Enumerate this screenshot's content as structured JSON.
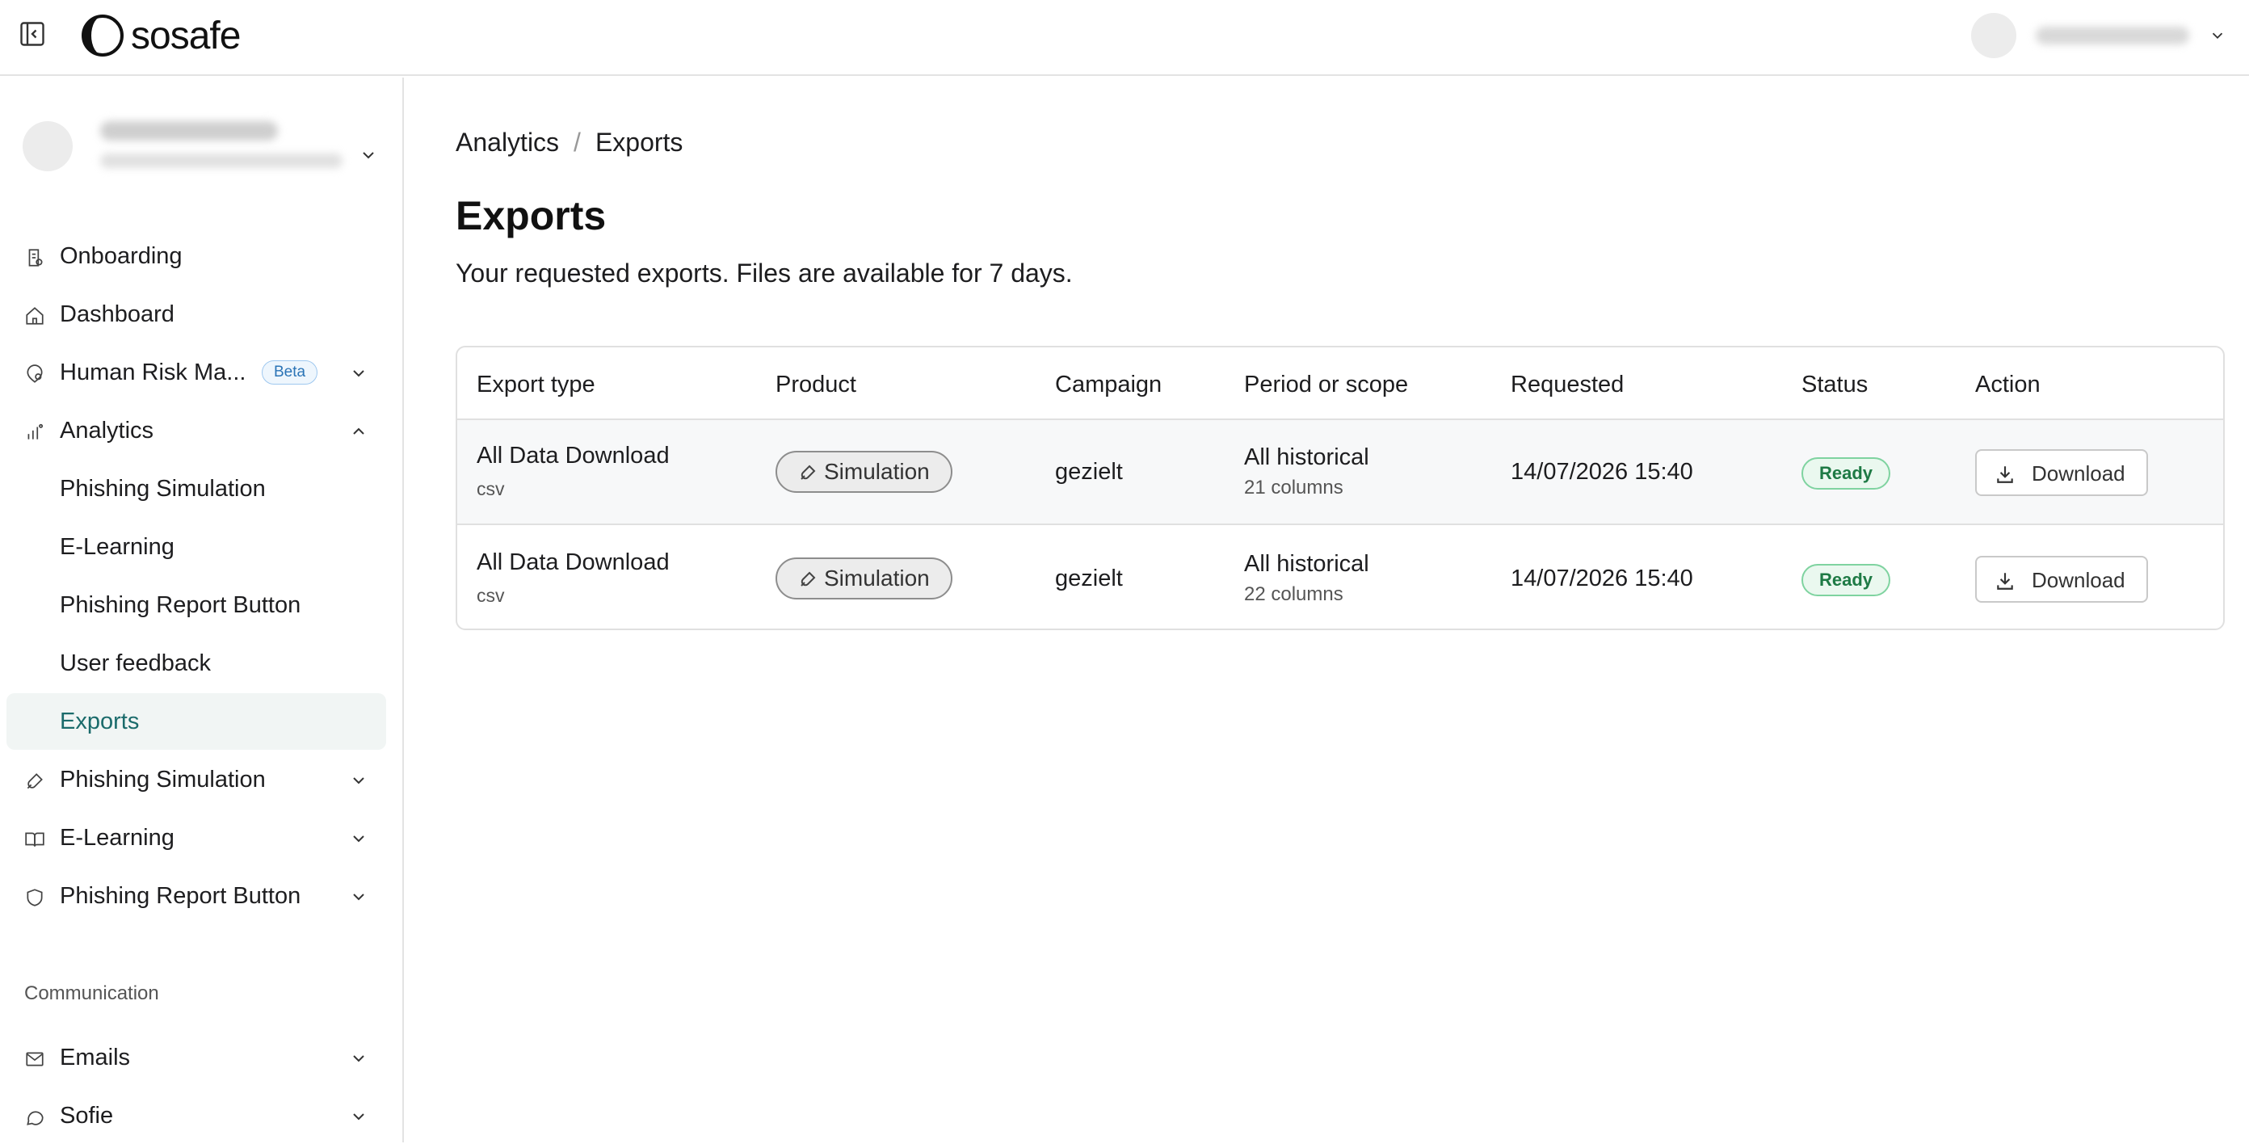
{
  "header": {
    "brand": "sosafe"
  },
  "sidebar": {
    "items": [
      {
        "label": "Onboarding"
      },
      {
        "label": "Dashboard"
      },
      {
        "label": "Human Risk Ma...",
        "badge": "Beta"
      },
      {
        "label": "Analytics"
      },
      {
        "label": "Phishing Simulation"
      },
      {
        "label": "E-Learning"
      },
      {
        "label": "Phishing Report Button"
      },
      {
        "label": "User feedback"
      },
      {
        "label": "Exports"
      },
      {
        "label": "Phishing Simulation"
      },
      {
        "label": "E-Learning"
      },
      {
        "label": "Phishing Report Button"
      },
      {
        "label": "Emails"
      },
      {
        "label": "Sofie"
      }
    ],
    "section_communication": "Communication"
  },
  "main": {
    "breadcrumb": [
      "Analytics",
      "/",
      "Exports"
    ],
    "title": "Exports",
    "description": "Your requested exports. Files are available for 7 days.",
    "table": {
      "columns": [
        "Export type",
        "Product",
        "Campaign",
        "Period or scope",
        "Requested",
        "Status",
        "Action"
      ],
      "rows": [
        {
          "type": "All Data Download",
          "format": "csv",
          "product": "Simulation",
          "campaign": "gezielt",
          "period": "All historical",
          "columns_count": "21 columns",
          "requested": "14/07/2026 15:40",
          "status": "Ready",
          "action": "Download"
        },
        {
          "type": "All Data Download",
          "format": "csv",
          "product": "Simulation",
          "campaign": "gezielt",
          "period": "All historical",
          "columns_count": "22 columns",
          "requested": "14/07/2026 15:40",
          "status": "Ready",
          "action": "Download"
        }
      ]
    }
  },
  "colors": {
    "accent": "#1b6b6b",
    "active_bg": "#f1f5f4",
    "ready_text": "#1e7a45",
    "ready_bg": "#eaf8ef",
    "beta_text": "#2b74b6"
  }
}
